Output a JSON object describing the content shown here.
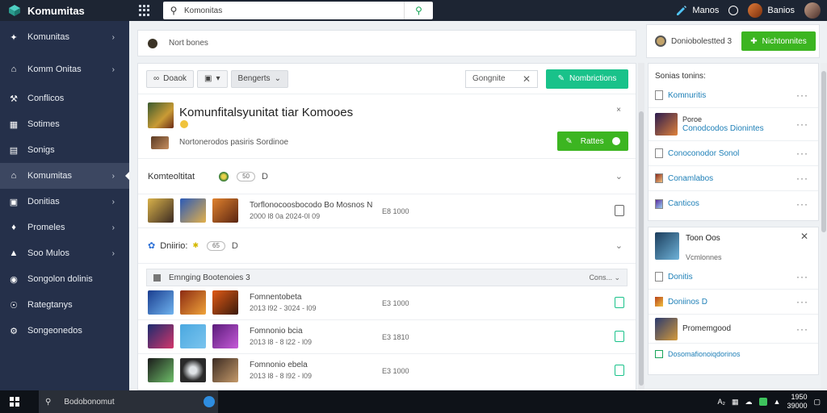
{
  "app": {
    "title": "Komumitas"
  },
  "search": {
    "value": "Komonitas"
  },
  "topbar": {
    "user1": "Manos",
    "user2": "Banios"
  },
  "sidebar": {
    "items": [
      {
        "label": "Komunitas",
        "icon": "puzzle-icon"
      },
      {
        "label": "Komm Onitas",
        "icon": "home-icon"
      },
      {
        "label": "Conflicos",
        "icon": "wrench-icon"
      },
      {
        "label": "Sotimes",
        "icon": "grid-icon"
      },
      {
        "label": "Sonigs",
        "icon": "document-icon"
      },
      {
        "label": "Komumitas",
        "icon": "house-icon"
      },
      {
        "label": "Donitias",
        "icon": "calendar-icon"
      },
      {
        "label": "Promeles",
        "icon": "puzzle-piece-icon"
      },
      {
        "label": "Soo Mulos",
        "icon": "chart-icon"
      },
      {
        "label": "Songolon dolinis",
        "icon": "settings-icon"
      },
      {
        "label": "Rategtanys",
        "icon": "tag-icon"
      },
      {
        "label": "Songeonedos",
        "icon": "gear-icon"
      }
    ]
  },
  "post_box": {
    "placeholder": "Nort bones"
  },
  "toolbar": {
    "btn1": "Doaok",
    "btn2": "",
    "btn3": "Bengerts",
    "filter": "Gongnite",
    "new_button": "Nombrictions"
  },
  "featured": {
    "title": "Komunfitalsyunitat tiar Komooes",
    "meta": "Nortonerodos pasiris Sordinoe",
    "pin": "×",
    "action": "Rattes"
  },
  "sections": [
    {
      "title": "Komteoltitat",
      "pill": "50",
      "num": "D"
    },
    {
      "title": "Dniirio:",
      "pill": "65",
      "num": "D"
    }
  ],
  "rows_a": [
    {
      "title": "Torflonocoosbocodo Bo Mosnos N",
      "sub": "2000 l8 0a 2024-0l 09",
      "mid": "E8 1000"
    }
  ],
  "group": {
    "title": "Emnging Bootenoies 3",
    "right": "Cons..."
  },
  "rows_b": [
    {
      "title": "Fomnentobeta",
      "sub": "2013 l92 - 3024 - l09",
      "mid": "E3 1000"
    },
    {
      "title": "Fomnonio bcia",
      "sub": "2013 l8 - 8 l22 - l09",
      "mid": "E3 1810"
    },
    {
      "title": "Fomnonio ebela",
      "sub": "2013 l8 - 8 l92 - l09",
      "mid": "E3 1000"
    }
  ],
  "right_top": {
    "text": "Doniobolestted 3",
    "button": "Nichtonnites"
  },
  "right_card1": {
    "title": "Sonias tonins:",
    "items": [
      {
        "label": "Komnuritis",
        "sub": ""
      },
      {
        "label": "Conodcodos Dionintes",
        "sub": "Poroe"
      },
      {
        "label": "Conoconodor Sonol",
        "sub": ""
      },
      {
        "label": "Conamlabos",
        "sub": ""
      },
      {
        "label": "Canticos",
        "sub": ""
      }
    ]
  },
  "right_card2": {
    "title": "Toon Oos",
    "subtitle": "Vcmlonnes",
    "items": [
      {
        "label": "Donitis"
      },
      {
        "label": "Doniinos D"
      },
      {
        "label": "Promemgood"
      }
    ],
    "footer": "Dosomafionoiqdorinos"
  },
  "taskbar": {
    "search": "Bodobonomut",
    "time": "1950",
    "date": "39000"
  }
}
